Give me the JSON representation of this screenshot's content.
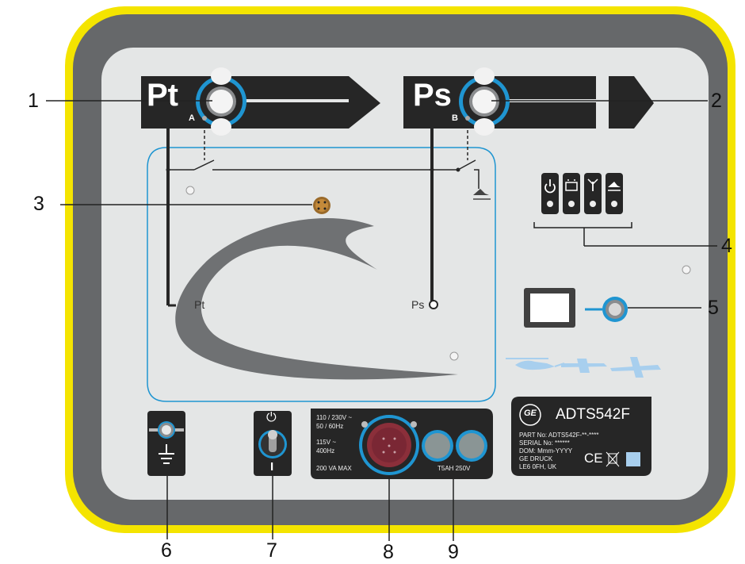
{
  "ports": {
    "pt_label": "Pt",
    "ps_label": "Ps",
    "pt_sub": "A",
    "ps_sub": "B"
  },
  "diagram": {
    "pt_label": "Pt",
    "ps_label": "Ps"
  },
  "callouts": [
    "1",
    "2",
    "3",
    "4",
    "5",
    "6",
    "7",
    "8",
    "9"
  ],
  "power_panel": {
    "line1": "110 / 230V ~",
    "line2": "50 / 60Hz",
    "line3": "115V ~",
    "line4": "400Hz",
    "line5": "200 VA MAX",
    "fuse": "T5AH 250V"
  },
  "switch_marks": {
    "on": "⏻",
    "off": "I"
  },
  "nameplate": {
    "brand": "GE",
    "model": "ADTS542F",
    "part_no": "PART No: ADTS542F-**-****",
    "serial_no": "SERIAL No: ******",
    "dom": "DOM: Mmm-YYYY",
    "maker": "GE DRUCK",
    "address": "LE6 0FH, UK",
    "ce": "CE"
  },
  "status_icons": [
    "power-icon",
    "battery-icon",
    "antenna-icon",
    "aircraft-icon"
  ],
  "colors": {
    "case_yellow": "#f4e400",
    "case_dark": "#6a6b6d",
    "panel": "#e4e6e6",
    "accent_blue": "#1f95d1",
    "plate": "#262626"
  }
}
